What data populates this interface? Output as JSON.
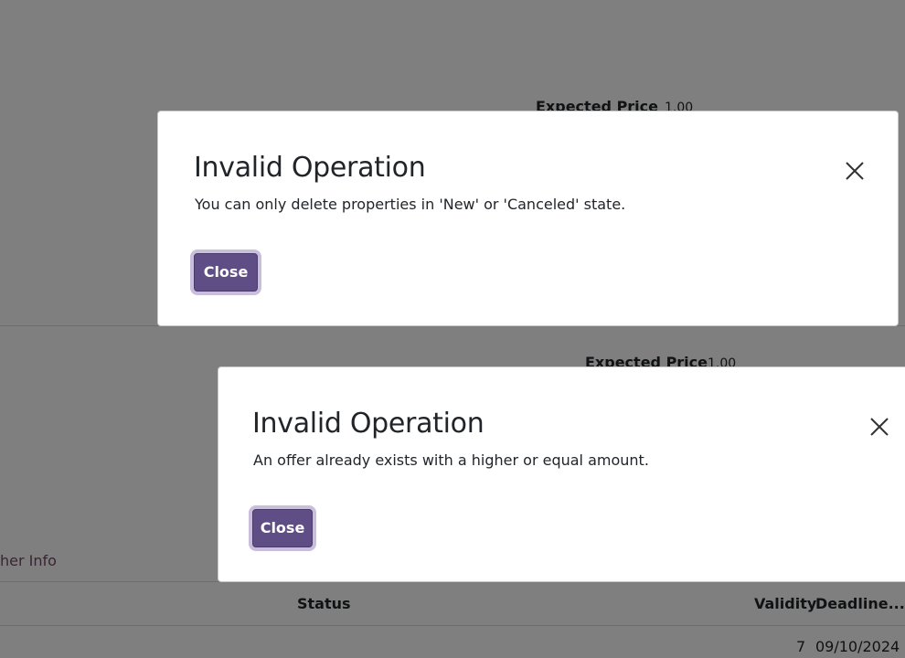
{
  "background": {
    "expected_price_label_1": "Expected Price",
    "expected_price_value_1": "1.00",
    "expected_price_label_2": "Expected Price",
    "expected_price_value_2": "1.00",
    "other_info_tab": "her Info",
    "table_headers": {
      "status": "Status",
      "validity": "Validity",
      "deadline": "Deadline..."
    },
    "table_row": {
      "validity": "7",
      "deadline": "09/10/2024"
    }
  },
  "dialogs": [
    {
      "title": "Invalid Operation",
      "message": "You can only delete properties in 'New' or 'Canceled' state.",
      "close_label": "Close",
      "close_icon": "close-icon"
    },
    {
      "title": "Invalid Operation",
      "message": "An offer already exists with a higher or equal amount.",
      "close_label": "Close",
      "close_icon": "close-icon"
    }
  ],
  "colors": {
    "primary_button": "#5f4d85",
    "overlay": "rgba(0,0,0,0.5)",
    "link": "#714b67"
  }
}
